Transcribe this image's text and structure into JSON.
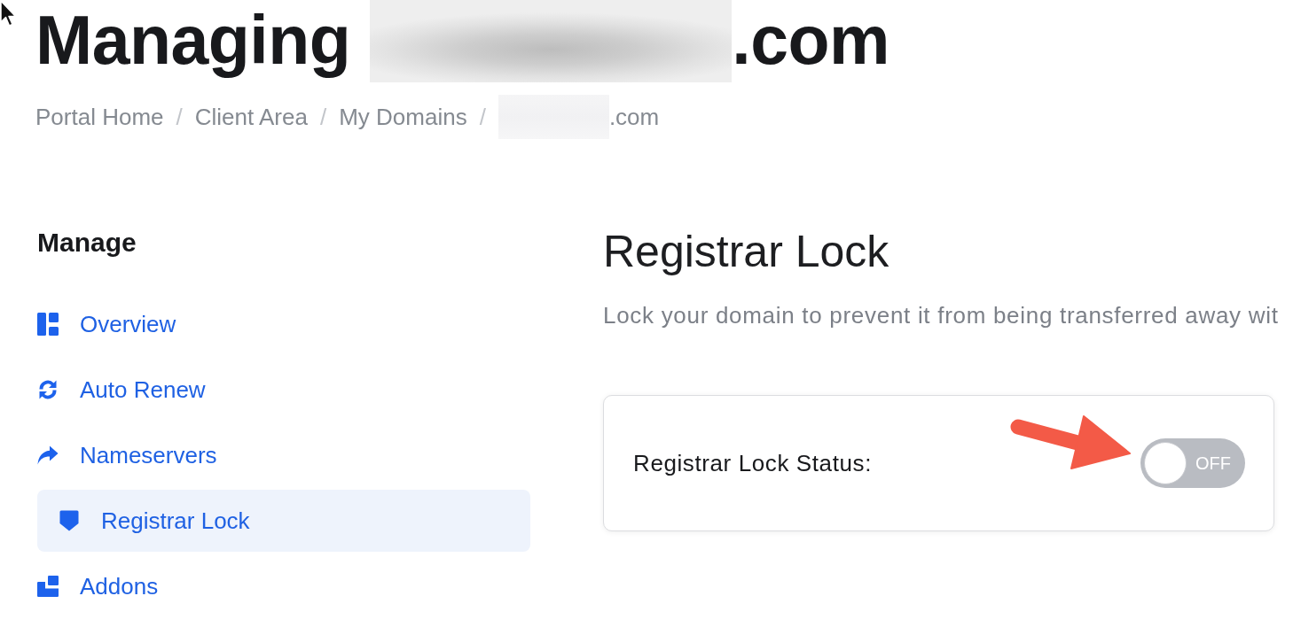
{
  "page_title": {
    "prefix": "Managing",
    "redacted": true,
    "suffix": ".com"
  },
  "breadcrumb": [
    {
      "label": "Portal Home",
      "separator": "/"
    },
    {
      "label": "Client Area",
      "separator": "/"
    },
    {
      "label": "My Domains",
      "separator": "/"
    },
    {
      "label": ".com",
      "redacted": true
    }
  ],
  "sidebar": {
    "heading": "Manage",
    "items": [
      {
        "label": "Overview",
        "selected": false
      },
      {
        "label": "Auto Renew",
        "selected": false
      },
      {
        "label": "Nameservers",
        "selected": false
      },
      {
        "label": "Registrar Lock",
        "selected": true
      },
      {
        "label": "Addons",
        "selected": false
      }
    ]
  },
  "content": {
    "heading": "Registrar Lock",
    "description": "Lock your domain to prevent it from being transferred away wit",
    "status": {
      "label": "Registrar Lock Status:",
      "on": false,
      "state_text": "OFF"
    }
  }
}
